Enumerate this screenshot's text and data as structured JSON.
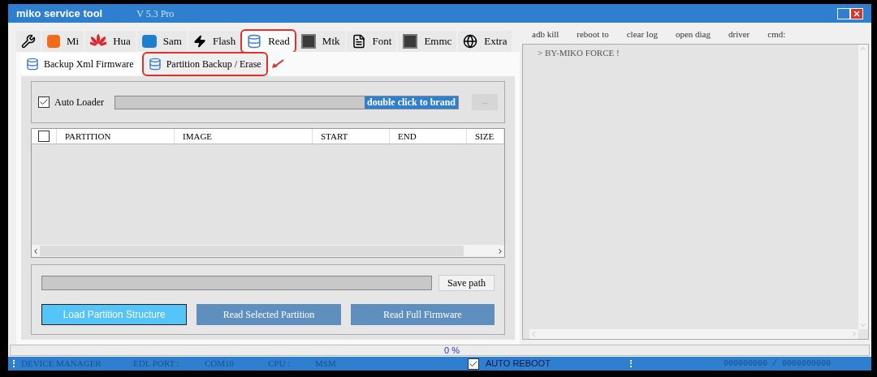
{
  "window": {
    "title": "miko service tool",
    "version": "V 5.3 Pro"
  },
  "tabs": [
    {
      "kind": "tools",
      "selected": false,
      "annotated": false
    },
    {
      "kind": "mi",
      "label": "Mi",
      "selected": false,
      "annotated": false
    },
    {
      "kind": "hua",
      "label": "Hua",
      "selected": false,
      "annotated": false
    },
    {
      "kind": "sam",
      "label": "Sam",
      "selected": false,
      "annotated": false
    },
    {
      "kind": "flash",
      "label": "Flash",
      "selected": false,
      "annotated": false
    },
    {
      "kind": "db",
      "label": "Read",
      "selected": true,
      "annotated": true
    },
    {
      "kind": "chip",
      "label": "Mtk",
      "selected": false,
      "annotated": false
    },
    {
      "kind": "file",
      "label": "Font",
      "selected": false,
      "annotated": false
    },
    {
      "kind": "chip",
      "label": "Emmc",
      "selected": false,
      "annotated": false
    },
    {
      "kind": "globe",
      "label": "Extra",
      "selected": false,
      "annotated": false
    }
  ],
  "subtabs": [
    {
      "label": "Backup Xml Firmware",
      "selected": true,
      "annotated": false
    },
    {
      "label": "Partition Backup / Erase",
      "selected": false,
      "annotated": true
    }
  ],
  "auto_loader": {
    "label": "Auto Loader",
    "checked": true,
    "field_value": "double click to brand",
    "button": "..."
  },
  "table": {
    "header_checked": false,
    "columns": [
      "PARTITION",
      "IMAGE",
      "START",
      "END",
      "SIZE"
    ]
  },
  "save_path": {
    "button": "Save path"
  },
  "buttons": [
    {
      "label": "Load Partition Structure",
      "selected": true
    },
    {
      "label": "Read Selected Partition",
      "selected": false
    },
    {
      "label": "Read Full Firmware",
      "selected": false
    }
  ],
  "progress": {
    "level": 0,
    "reading": "0 %"
  },
  "status_bar": {
    "device_manager": "DEVICE MANAGER",
    "edl_label": "EDL PORT :",
    "edl_value": "COM10",
    "cpu_label": "CPU :",
    "cpu_value": "MSM",
    "auto_reboot": {
      "label": "AUTO REBOOT",
      "checked": true
    },
    "counter": "000000000 / 0000000000"
  },
  "toolbar": [
    "adb kill",
    "reboot to",
    "clear log",
    "open diag",
    "driver",
    "cmd:"
  ],
  "log": [
    "> BY-MIKO FORCE !"
  ]
}
